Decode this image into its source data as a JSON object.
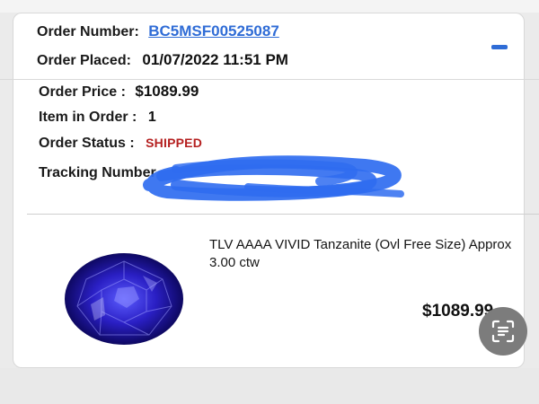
{
  "order": {
    "number_label": "Order Number:",
    "number": "BC5MSF00525087",
    "placed_label": "Order Placed:",
    "placed": "01/07/2022 11:51 PM",
    "price_label": "Order Price :",
    "price": "$1089.99",
    "items_label": "Item in Order :",
    "items": "1",
    "status_label": "Order Status :",
    "status": "SHIPPED",
    "tracking_label": "Tracking Number"
  },
  "product": {
    "title": "TLV AAAA VIVID Tanzanite (Ovl Free Size) Approx 3.00 ctw",
    "price": "$1089.99"
  },
  "icons": {
    "collapse": "minus-icon",
    "scan": "text-scan-icon"
  },
  "colors": {
    "link": "#2f6cd6",
    "status": "#b52020",
    "redaction": "#2f6cf0"
  }
}
